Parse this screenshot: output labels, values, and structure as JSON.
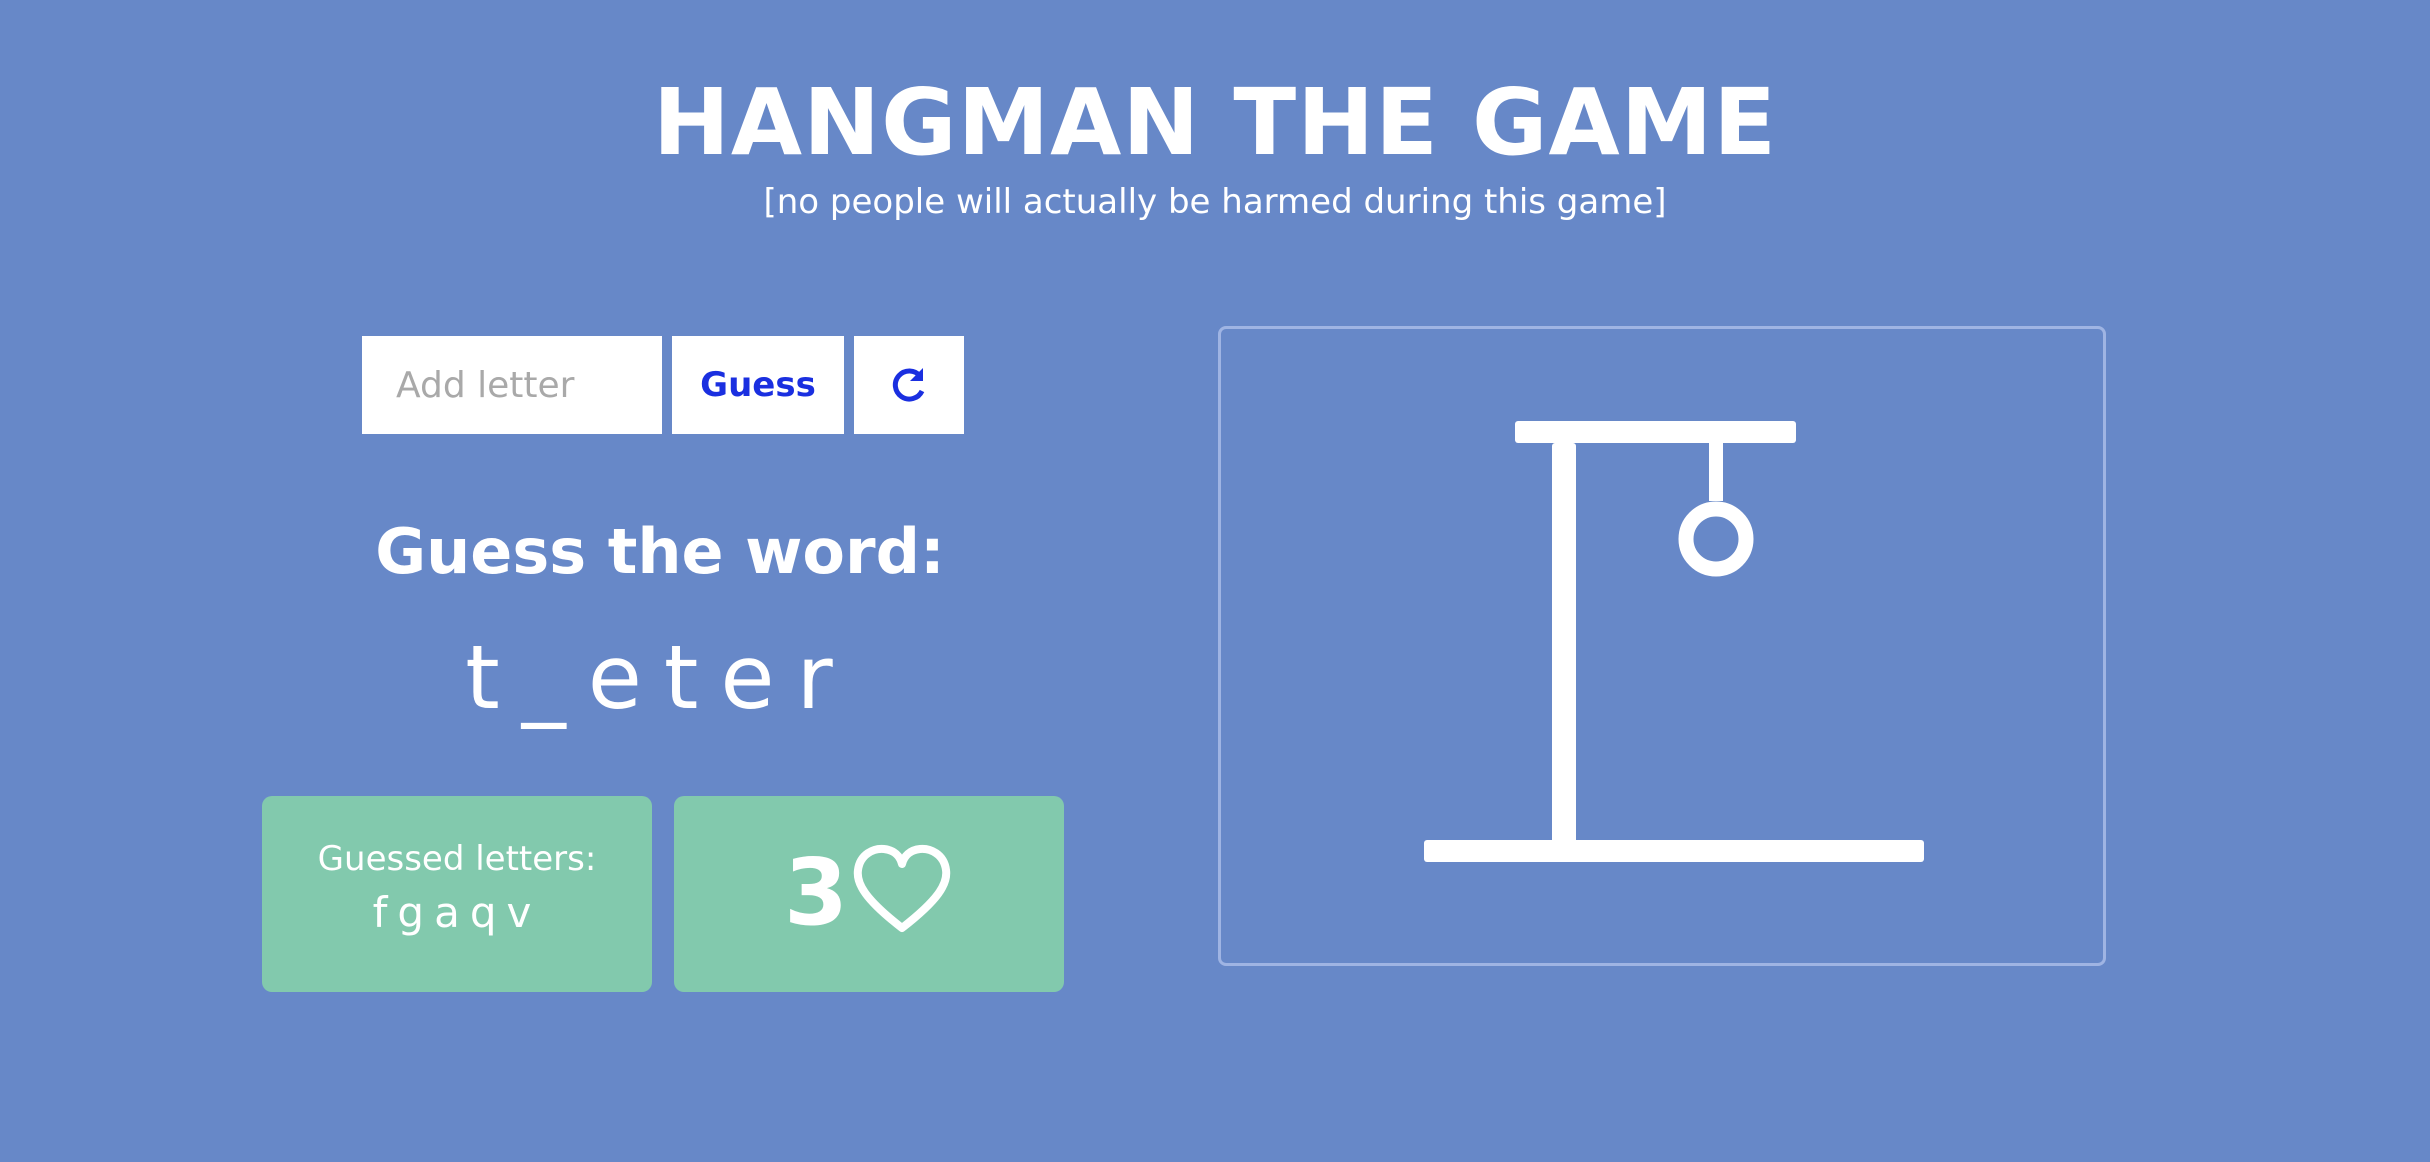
{
  "header": {
    "title": "HANGMAN THE GAME",
    "subtitle": "[no people will actually be harmed during this game]"
  },
  "controls": {
    "letter_input_placeholder": "Add letter",
    "letter_input_value": "",
    "guess_label": "Guess",
    "reset_icon": "refresh-icon"
  },
  "game": {
    "prompt": "Guess the word:",
    "word_display": "t_eter",
    "guessed_label": "Guessed letters:",
    "guessed_letters": "fgaqv",
    "lives": "3",
    "lives_icon": "heart-icon"
  },
  "drawing": {
    "parts_shown": [
      "base",
      "pole",
      "beam",
      "rope",
      "head"
    ]
  },
  "colors": {
    "background": "#6788c8",
    "accent_text": "#1a2fe0",
    "panel": "#82c9ad",
    "drawing_frame": "#9fb4e3"
  }
}
